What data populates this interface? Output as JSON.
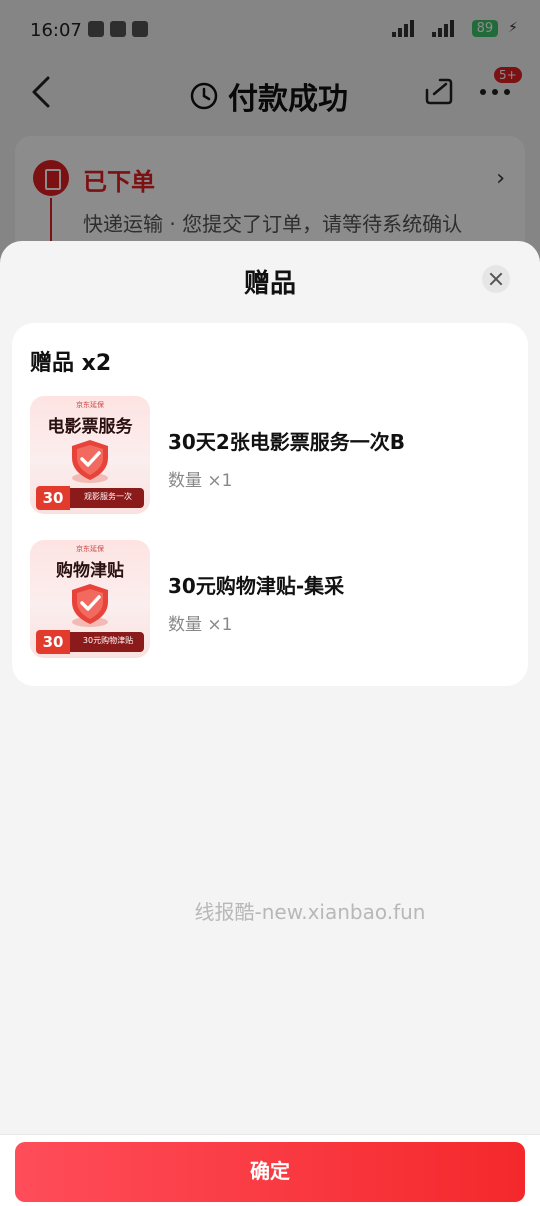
{
  "status_bar": {
    "time": "16:07",
    "battery": "89"
  },
  "nav": {
    "title": "付款成功",
    "more_badge": "5+"
  },
  "order": {
    "status": "已下单",
    "description": "快递运输 · 您提交了订单，请等待系统确认"
  },
  "sheet": {
    "title": "赠品",
    "gift_header": "赠品 x2",
    "items": [
      {
        "thumb_brand": "京东延保",
        "thumb_title": "电影票服务",
        "thumb_num": "30",
        "thumb_tag": "观影服务一次",
        "name": "30天2张电影票服务一次B",
        "qty": "数量 ×1"
      },
      {
        "thumb_brand": "京东延保",
        "thumb_title": "购物津贴",
        "thumb_num": "30",
        "thumb_tag": "30元购物津贴",
        "name": "30元购物津贴-集采",
        "qty": "数量 ×1"
      }
    ],
    "watermark": "线报酷-new.xianbao.fun",
    "confirm_label": "确定"
  },
  "colors": {
    "brand_red": "#e21f26",
    "button_gradient_start": "#ff4d5a",
    "button_gradient_end": "#f4282b"
  }
}
